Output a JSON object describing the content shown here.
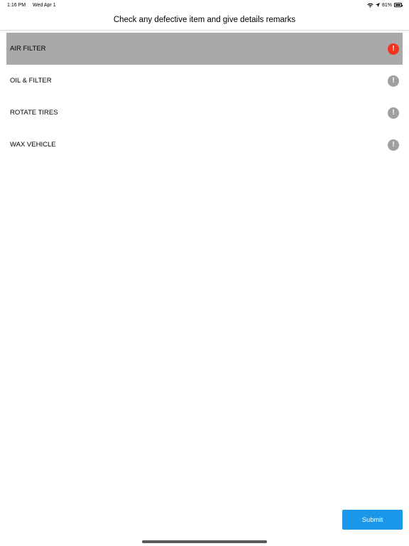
{
  "status_bar": {
    "time": "1:16 PM",
    "date": "Wed Apr 1",
    "battery_percent": "81%",
    "battery_level": 0.81,
    "icons": [
      "wifi-icon",
      "location-icon",
      "battery-icon"
    ]
  },
  "header": {
    "title": "Check any defective item and give details remarks"
  },
  "items": [
    {
      "label": "AIR FILTER",
      "selected": true,
      "icon": "exclamation-icon",
      "icon_color": "#f4331f"
    },
    {
      "label": "OIL & FILTER",
      "selected": false,
      "icon": "exclamation-icon",
      "icon_color": "#a0a0a0"
    },
    {
      "label": "ROTATE TIRES",
      "selected": false,
      "icon": "exclamation-icon",
      "icon_color": "#a0a0a0"
    },
    {
      "label": "WAX VEHICLE",
      "selected": false,
      "icon": "exclamation-icon",
      "icon_color": "#a0a0a0"
    }
  ],
  "alert_glyph": "!",
  "submit": {
    "label": "Submit"
  },
  "colors": {
    "accent": "#1a97e8",
    "selected_row": "#a9a9a9",
    "alert_active": "#f4331f",
    "alert_inactive": "#a0a0a0"
  }
}
